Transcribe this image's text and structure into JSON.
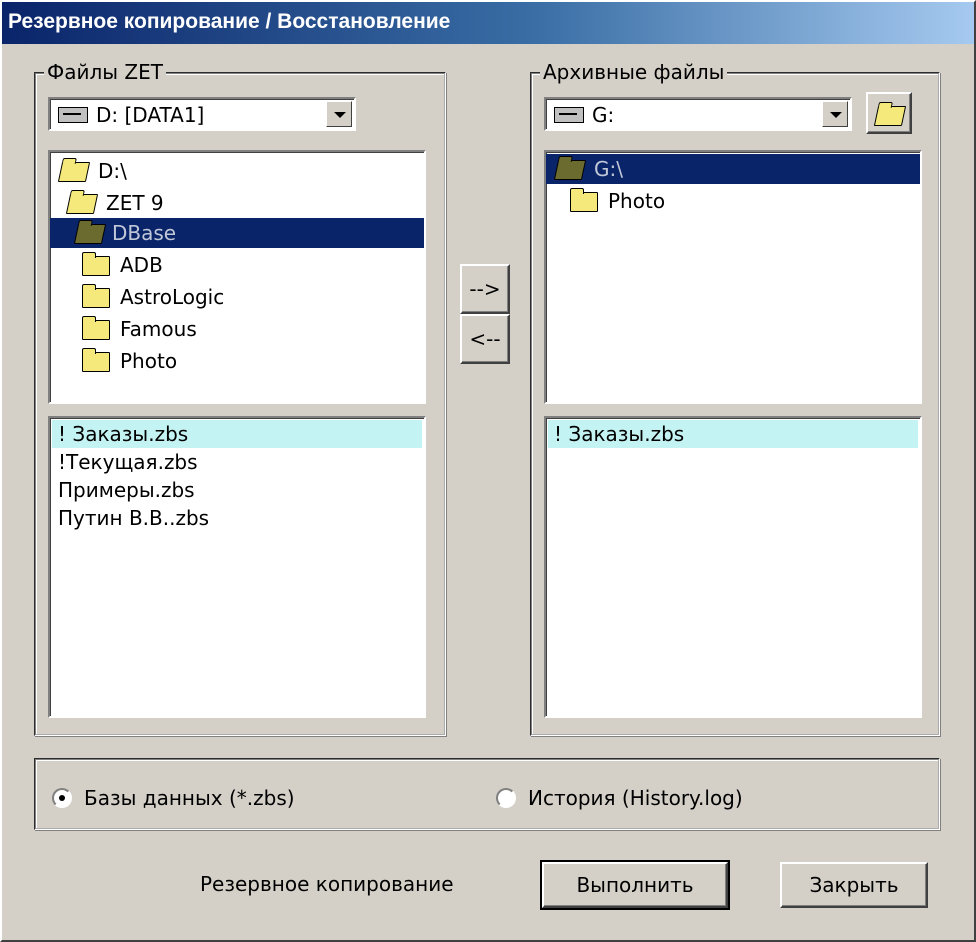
{
  "window": {
    "title": "Резервное копирование / Восстановление"
  },
  "left": {
    "group_label": "Файлы ZET",
    "drive": "D: [DATA1]",
    "tree": [
      {
        "label": "D:\\"
      },
      {
        "label": "ZET 9"
      },
      {
        "label": "DBase"
      },
      {
        "label": "ADB"
      },
      {
        "label": "AstroLogic"
      },
      {
        "label": "Famous"
      },
      {
        "label": "Photo"
      }
    ],
    "files": [
      "! Заказы.zbs",
      "!Текущая.zbs",
      "Примеры.zbs",
      "Путин В.В..zbs"
    ]
  },
  "right": {
    "group_label": "Архивные файлы",
    "drive": "G:",
    "tree": [
      {
        "label": "G:\\"
      },
      {
        "label": "Photo"
      }
    ],
    "files": [
      "! Заказы.zbs"
    ]
  },
  "transfer": {
    "to_archive": "-->",
    "from_archive": "<--"
  },
  "options": {
    "radio_db": "Базы данных (*.zbs)",
    "radio_history": "История (History.log)",
    "selected": "radio_db"
  },
  "footer": {
    "mode": "Резервное копирование",
    "execute": "Выполнить",
    "close": "Закрыть"
  },
  "icons": [
    "drive-icon",
    "folder-icon",
    "open-folder-icon",
    "dropdown-arrow-icon",
    "browse-folder-icon"
  ]
}
